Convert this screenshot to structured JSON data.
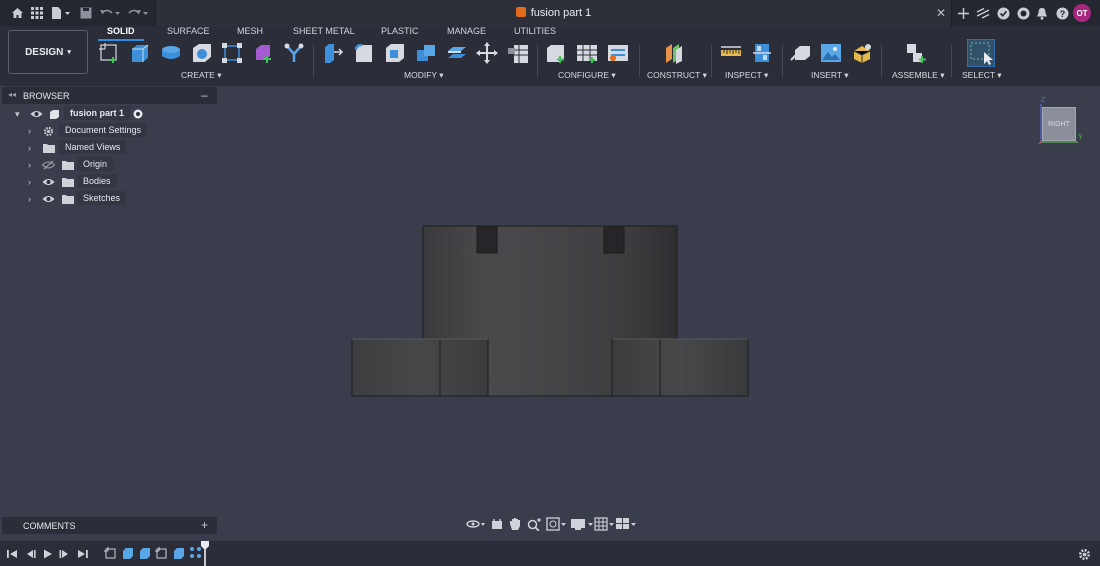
{
  "title_bar": {
    "document_title": "fusion part 1",
    "user_initials": "OT",
    "icons": [
      "home-icon",
      "apps-grid-icon",
      "file-icon",
      "save-icon",
      "undo-icon",
      "redo-icon",
      "close-tab-icon",
      "new-tab-icon",
      "extensions-icon",
      "job-status-icon",
      "online-status-icon",
      "notifications-icon",
      "help-icon"
    ]
  },
  "toolbar": {
    "workspace_label": "DESIGN",
    "workspace_tabs": [
      "SOLID",
      "SURFACE",
      "MESH",
      "SHEET METAL",
      "PLASTIC",
      "MANAGE",
      "UTILITIES"
    ],
    "active_tab": "SOLID",
    "groups": [
      "CREATE",
      "MODIFY",
      "CONFIGURE",
      "CONSTRUCT",
      "INSPECT",
      "INSERT",
      "ASSEMBLE",
      "SELECT"
    ],
    "accent": "#2f8de4"
  },
  "browser": {
    "title": "BROWSER",
    "root": "fusion part 1",
    "items": [
      {
        "label": "Document Settings",
        "icon": "gear-icon"
      },
      {
        "label": "Named Views",
        "icon": "folder-icon"
      },
      {
        "label": "Origin",
        "icon": "folder-icon",
        "visibility": "hidden-eye-icon"
      },
      {
        "label": "Bodies",
        "icon": "folder-icon",
        "visibility": "eye-icon"
      },
      {
        "label": "Sketches",
        "icon": "folder-icon",
        "visibility": "eye-icon"
      }
    ]
  },
  "comments": {
    "title": "COMMENTS"
  },
  "viewcube": {
    "face_label": "RIGHT",
    "axis_x": "Z",
    "axis_y": "Y"
  },
  "colors": {
    "background": "#3a3e4c",
    "panel": "#2b2e38",
    "titlebar": "#24272f",
    "doc_icon": "#e46a1c",
    "avatar": "#a7277f"
  }
}
